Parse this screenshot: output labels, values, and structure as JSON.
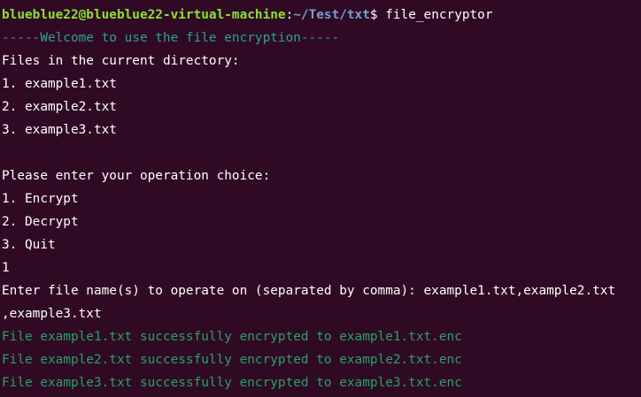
{
  "colors": {
    "background": "#300a24",
    "text": "#ffffff",
    "prompt_user": "#8ae234",
    "prompt_path": "#729fcf",
    "welcome": "#2aa198",
    "success": "#26a269"
  },
  "prompt": {
    "user_host": "blueblue22@blueblue22-virtual-machine",
    "colon": ":",
    "path": "~/Test/txt",
    "symbol": "$ ",
    "command": "file_encryptor"
  },
  "output": {
    "welcome": "-----Welcome to use the file encryption-----",
    "files_header": "Files in the current directory:",
    "files": [
      "1. example1.txt",
      "2. example2.txt",
      "3. example3.txt"
    ],
    "choice_header": "Please enter your operation choice:",
    "choices": [
      "1. Encrypt",
      "2. Decrypt",
      "3. Quit"
    ],
    "user_choice": "1",
    "filename_prompt": "Enter file name(s) to operate on (separated by comma): example1.txt,example2.txt",
    "filename_prompt_wrap": ",example3.txt",
    "results": [
      "File example1.txt successfully encrypted to example1.txt.enc",
      "File example2.txt successfully encrypted to example2.txt.enc",
      "File example3.txt successfully encrypted to example3.txt.enc"
    ]
  }
}
